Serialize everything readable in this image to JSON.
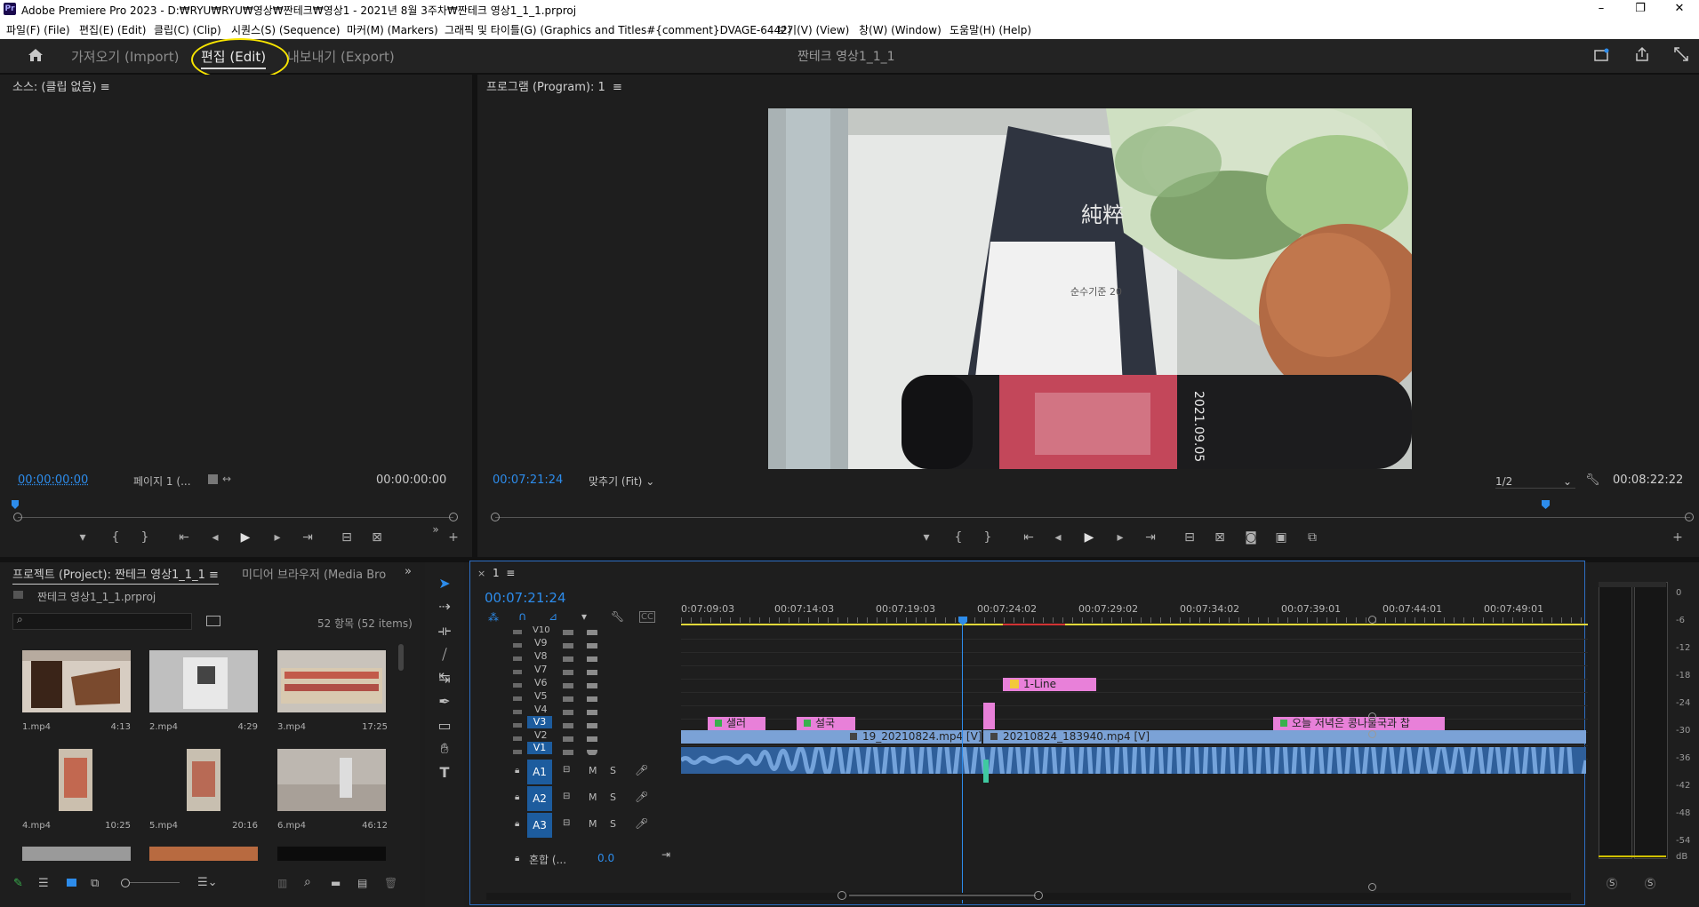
{
  "titlebar": {
    "logo": "Pr",
    "title": "Adobe Premiere Pro 2023 - D:₩RYU₩RYU₩영상₩짠테크₩영상1 - 2021년 8월 3주차₩짠테크 영상1_1_1.prproj",
    "min": "–",
    "max": "❐",
    "close": "✕"
  },
  "menu": [
    "파일(F) (File)",
    "편집(E) (Edit)",
    "클립(C) (Clip)",
    "시퀀스(S) (Sequence)",
    "마커(M) (Markers)",
    "그래픽 및 타이틀(G) (Graphics and Titles#{comment}DVAGE-6442)",
    "보기(V) (View)",
    "창(W) (Window)",
    "도움말(H) (Help)"
  ],
  "workspace": {
    "import": "가져오기 (Import)",
    "edit": "편집 (Edit)",
    "export": "내보내기 (Export)",
    "project_title": "짠테크 영상1_1_1"
  },
  "source": {
    "header": "소스: (클립 없음)",
    "menu_glyph": "≡",
    "tc_left": "00:00:00:00",
    "page": "페이지 1 (...",
    "tc_right": "00:00:00:00"
  },
  "program": {
    "header": "프로그램 (Program): 1",
    "menu_glyph": "≡",
    "tc_left": "00:07:21:24",
    "fit": "맞추기 (Fit)",
    "quality": "1/2",
    "tc_right": "00:08:22:22",
    "bottle_date": "2021.09.05",
    "pack_text": "순수기준 20",
    "pack_logo": "純粹"
  },
  "project": {
    "tab1": "프로젝트 (Project): 짠테크 영상1_1_1",
    "tab2": "미디어 브라우저 (Media Bro",
    "file": "짠테크 영상1_1_1.prproj",
    "count": "52 항목 (52 items)",
    "items": [
      {
        "name": "1.mp4",
        "dur": "4:13"
      },
      {
        "name": "2.mp4",
        "dur": "4:29"
      },
      {
        "name": "3.mp4",
        "dur": "17:25"
      },
      {
        "name": "4.mp4",
        "dur": "10:25"
      },
      {
        "name": "5.mp4",
        "dur": "20:16"
      },
      {
        "name": "6.mp4",
        "dur": "46:12"
      }
    ]
  },
  "timeline": {
    "tab": "1",
    "timecode": "00:07:21:24",
    "ruler": [
      "0:07:09:03",
      "00:07:14:03",
      "00:07:19:03",
      "00:07:24:02",
      "00:07:29:02",
      "00:07:34:02",
      "00:07:39:01",
      "00:07:44:01",
      "00:07:49:01"
    ],
    "video_tracks": [
      "V10",
      "V9",
      "V8",
      "V7",
      "V6",
      "V5",
      "V4",
      "V3",
      "V2",
      "V1"
    ],
    "audio_tracks": [
      "A1",
      "A2",
      "A3"
    ],
    "mix_label": "혼합 (...",
    "mix_value": "0.0",
    "clips": {
      "title_fx": "1-Line",
      "salad": "샐러",
      "soup": "설국",
      "dinner": "오늘 저녁은 콩나물국과 찹",
      "v1_a": "19_20210824.mp4 [V]",
      "v1_b": "20210824_183940.mp4 [V]"
    },
    "track_m": "M",
    "track_s": "S"
  },
  "meter": {
    "labels": [
      "0",
      "-6",
      "-12",
      "-18",
      "-24",
      "-30",
      "-36",
      "-42",
      "-48",
      "-54",
      "dB"
    ],
    "solo": [
      "S",
      "S"
    ]
  }
}
